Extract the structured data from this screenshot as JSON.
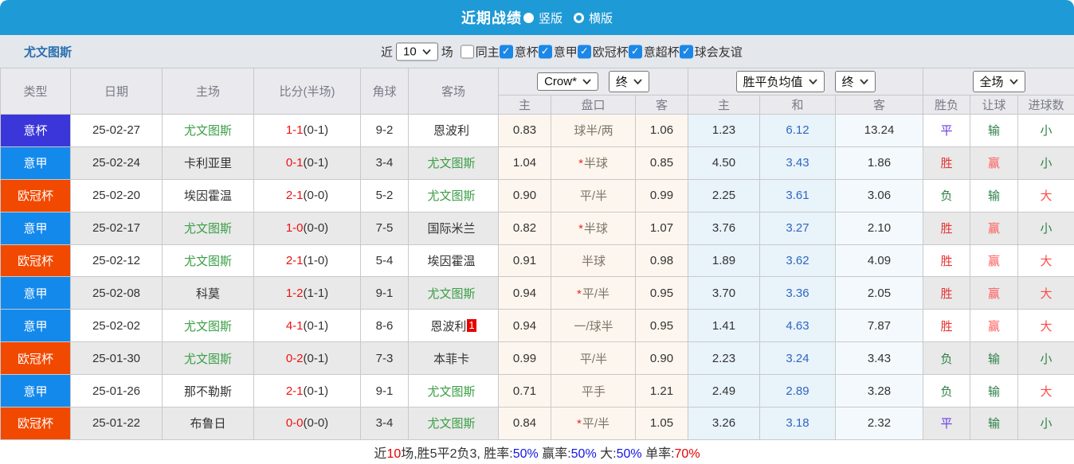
{
  "titlebar": {
    "title": "近期战绩",
    "radio_vertical": "竖版",
    "radio_horizontal": "横版"
  },
  "filterbar": {
    "team": "尤文图斯",
    "near_label": "近",
    "near_value": "10",
    "games_label": "场",
    "same_home_label": "同主",
    "leagues": [
      "意杯",
      "意甲",
      "欧冠杯",
      "意超杯",
      "球会友谊"
    ]
  },
  "table": {
    "highlight_team": "尤文图斯",
    "headers": {
      "type": "类型",
      "date": "日期",
      "home": "主场",
      "score": "比分(半场)",
      "corner": "角球",
      "away": "客场",
      "odds_group": {
        "bookmaker": "Crow*",
        "state": "终",
        "home": "主",
        "handicap": "盘口",
        "away": "客"
      },
      "europe_group": {
        "label": "胜平负均值",
        "state": "终",
        "home": "主",
        "draw": "和",
        "away": "客"
      },
      "result_group": {
        "label": "全场",
        "wdl": "胜负",
        "handicap": "让球",
        "goals": "进球数"
      }
    },
    "rows": [
      {
        "type": "意杯",
        "date": "25-02-27",
        "home": "尤文图斯",
        "score_ft": "1-1",
        "score_ht": "(0-1)",
        "corner": "9-2",
        "away": "恩波利",
        "away_badge": "",
        "o_home": "0.83",
        "star": false,
        "handicap": "球半/两",
        "o_away": "1.06",
        "e_home": "1.23",
        "e_draw": "6.12",
        "e_away": "13.24",
        "r_wdl": "平",
        "r_hcp": "输",
        "r_goal": "小"
      },
      {
        "type": "意甲",
        "date": "25-02-24",
        "home": "卡利亚里",
        "score_ft": "0-1",
        "score_ht": "(0-1)",
        "corner": "3-4",
        "away": "尤文图斯",
        "away_badge": "",
        "o_home": "1.04",
        "star": true,
        "handicap": "半球",
        "o_away": "0.85",
        "e_home": "4.50",
        "e_draw": "3.43",
        "e_away": "1.86",
        "r_wdl": "胜",
        "r_hcp": "赢",
        "r_goal": "小"
      },
      {
        "type": "欧冠杯",
        "date": "25-02-20",
        "home": "埃因霍温",
        "score_ft": "2-1",
        "score_ht": "(0-0)",
        "corner": "5-2",
        "away": "尤文图斯",
        "away_badge": "",
        "o_home": "0.90",
        "star": false,
        "handicap": "平/半",
        "o_away": "0.99",
        "e_home": "2.25",
        "e_draw": "3.61",
        "e_away": "3.06",
        "r_wdl": "负",
        "r_hcp": "输",
        "r_goal": "大"
      },
      {
        "type": "意甲",
        "date": "25-02-17",
        "home": "尤文图斯",
        "score_ft": "1-0",
        "score_ht": "(0-0)",
        "corner": "7-5",
        "away": "国际米兰",
        "away_badge": "",
        "o_home": "0.82",
        "star": true,
        "handicap": "半球",
        "o_away": "1.07",
        "e_home": "3.76",
        "e_draw": "3.27",
        "e_away": "2.10",
        "r_wdl": "胜",
        "r_hcp": "赢",
        "r_goal": "小"
      },
      {
        "type": "欧冠杯",
        "date": "25-02-12",
        "home": "尤文图斯",
        "score_ft": "2-1",
        "score_ht": "(1-0)",
        "corner": "5-4",
        "away": "埃因霍温",
        "away_badge": "",
        "o_home": "0.91",
        "star": false,
        "handicap": "半球",
        "o_away": "0.98",
        "e_home": "1.89",
        "e_draw": "3.62",
        "e_away": "4.09",
        "r_wdl": "胜",
        "r_hcp": "赢",
        "r_goal": "大"
      },
      {
        "type": "意甲",
        "date": "25-02-08",
        "home": "科莫",
        "score_ft": "1-2",
        "score_ht": "(1-1)",
        "corner": "9-1",
        "away": "尤文图斯",
        "away_badge": "",
        "o_home": "0.94",
        "star": true,
        "handicap": "平/半",
        "o_away": "0.95",
        "e_home": "3.70",
        "e_draw": "3.36",
        "e_away": "2.05",
        "r_wdl": "胜",
        "r_hcp": "赢",
        "r_goal": "大"
      },
      {
        "type": "意甲",
        "date": "25-02-02",
        "home": "尤文图斯",
        "score_ft": "4-1",
        "score_ht": "(0-1)",
        "corner": "8-6",
        "away": "恩波利",
        "away_badge": "1",
        "o_home": "0.94",
        "star": false,
        "handicap": "一/球半",
        "o_away": "0.95",
        "e_home": "1.41",
        "e_draw": "4.63",
        "e_away": "7.87",
        "r_wdl": "胜",
        "r_hcp": "赢",
        "r_goal": "大"
      },
      {
        "type": "欧冠杯",
        "date": "25-01-30",
        "home": "尤文图斯",
        "score_ft": "0-2",
        "score_ht": "(0-1)",
        "corner": "7-3",
        "away": "本菲卡",
        "away_badge": "",
        "o_home": "0.99",
        "star": false,
        "handicap": "平/半",
        "o_away": "0.90",
        "e_home": "2.23",
        "e_draw": "3.24",
        "e_away": "3.43",
        "r_wdl": "负",
        "r_hcp": "输",
        "r_goal": "小"
      },
      {
        "type": "意甲",
        "date": "25-01-26",
        "home": "那不勒斯",
        "score_ft": "2-1",
        "score_ht": "(0-1)",
        "corner": "9-1",
        "away": "尤文图斯",
        "away_badge": "",
        "o_home": "0.71",
        "star": false,
        "handicap": "平手",
        "o_away": "1.21",
        "e_home": "2.49",
        "e_draw": "2.89",
        "e_away": "3.28",
        "r_wdl": "负",
        "r_hcp": "输",
        "r_goal": "大"
      },
      {
        "type": "欧冠杯",
        "date": "25-01-22",
        "home": "布鲁日",
        "score_ft": "0-0",
        "score_ht": "(0-0)",
        "corner": "3-4",
        "away": "尤文图斯",
        "away_badge": "",
        "o_home": "0.84",
        "star": true,
        "handicap": "平/半",
        "o_away": "1.05",
        "e_home": "3.26",
        "e_draw": "3.18",
        "e_away": "2.32",
        "r_wdl": "平",
        "r_hcp": "输",
        "r_goal": "小"
      }
    ]
  },
  "footer": {
    "segments": [
      {
        "text": "近",
        "color": "#333333"
      },
      {
        "text": "10",
        "color": "#e60000"
      },
      {
        "text": "场,胜5平2负3, 胜率:",
        "color": "#333333"
      },
      {
        "text": "50%",
        "color": "#1414e6"
      },
      {
        "text": " 赢率:",
        "color": "#333333"
      },
      {
        "text": "50%",
        "color": "#1414e6"
      },
      {
        "text": " 大:",
        "color": "#333333"
      },
      {
        "text": "50%",
        "color": "#1414e6"
      },
      {
        "text": " 单率:",
        "color": "#333333"
      },
      {
        "text": "70%",
        "color": "#e60000"
      }
    ]
  },
  "colors": {
    "league": {
      "意杯": "#3b36d9",
      "意甲": "#1389ec",
      "欧冠杯": "#f24900"
    },
    "result": {
      "胜": "#e63535",
      "平": "#6a3ae6",
      "负": "#2e8048",
      "赢": "#ff5c5c",
      "输": "#2e8048",
      "大": "#ff4a42",
      "小": "#2e8048"
    },
    "highlight_team": "#3a9e46",
    "titlebar": "#1e9ad6"
  }
}
